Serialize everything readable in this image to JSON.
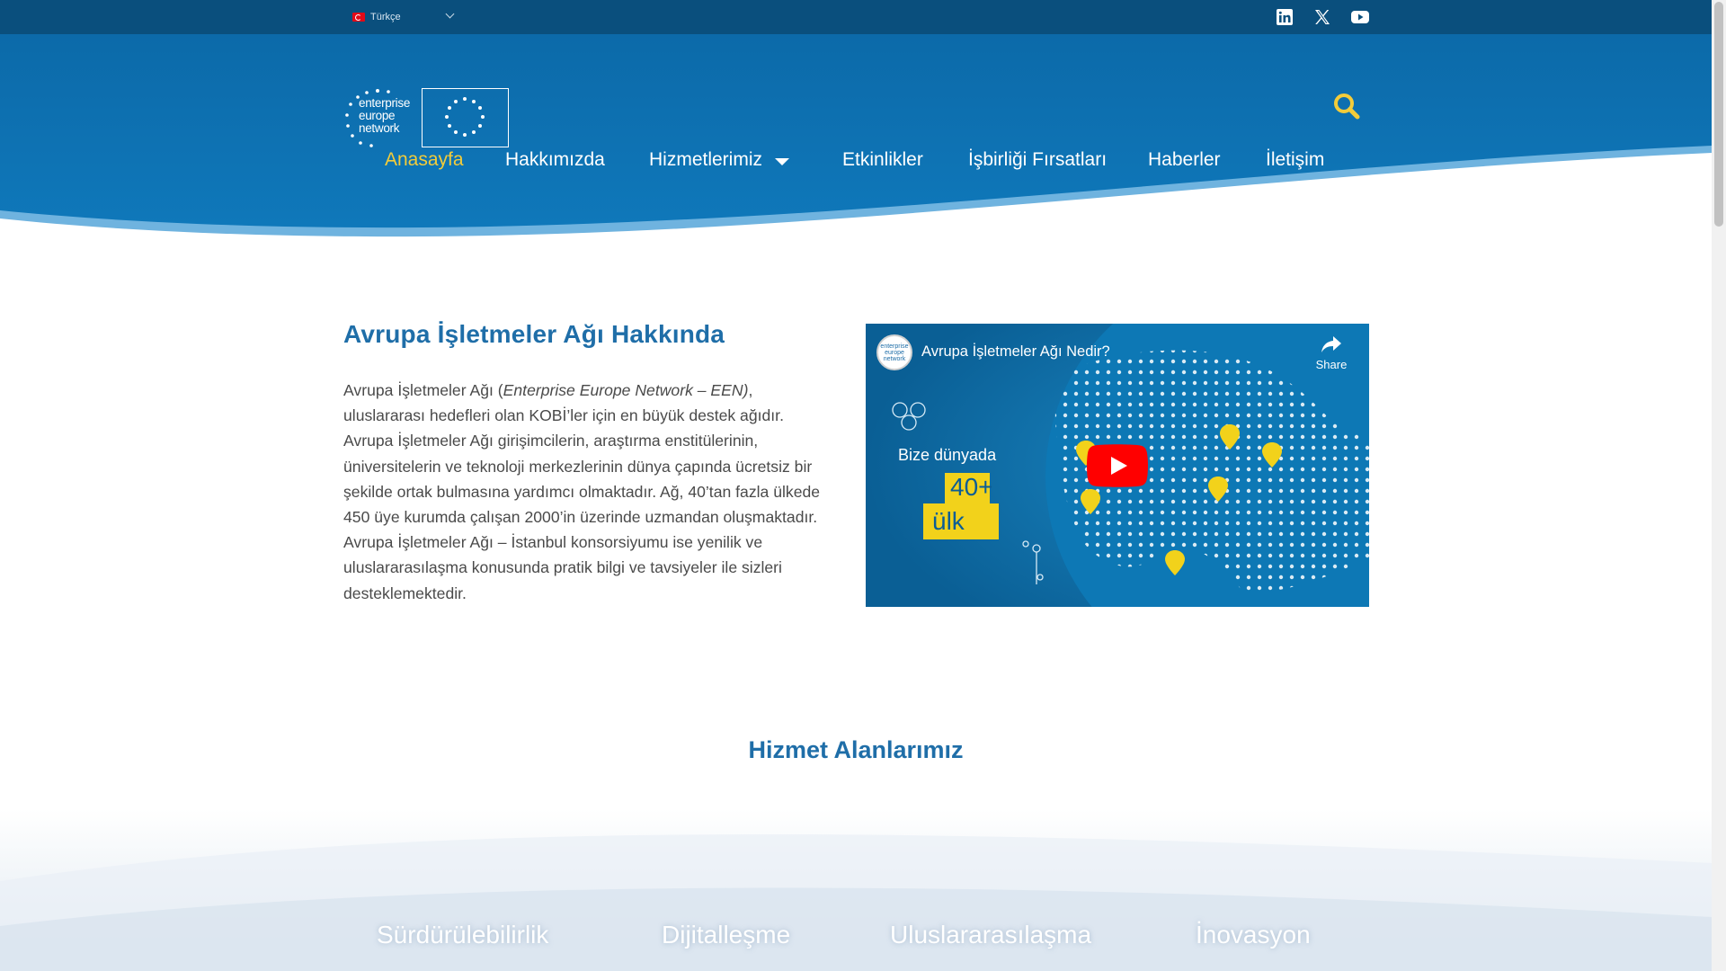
{
  "topbar": {
    "language": "Türkçe",
    "social": [
      "linkedin-icon",
      "x-icon",
      "youtube-icon"
    ]
  },
  "header": {
    "logo_text": [
      "enterprise",
      "europe",
      "network"
    ],
    "nav": [
      {
        "label": "Anasayfa",
        "active": true
      },
      {
        "label": "Hakkımızda"
      },
      {
        "label": "Hizmetlerimiz",
        "has_dropdown": true
      },
      {
        "label": "Etkinlikler"
      },
      {
        "label": "İşbirliği Fırsatları"
      },
      {
        "label": "Haberler"
      },
      {
        "label": "İletişim"
      }
    ]
  },
  "about": {
    "title": "Avrupa İşletmeler Ağı Hakkında",
    "text_pre": "Avrupa İşletmeler Ağı (",
    "text_italic": "Enterprise Europe Network – EEN)",
    "text_post": ", uluslararası hedefleri olan KOBİ’ler için en büyük destek ağıdır. Avrupa İşletmeler Ağı girişimcilerin, araştırma enstitülerinin, üniversitelerin ve teknoloji merkezlerinin dünya çapında ücretsiz bir şekilde ortak bulmasına yardımcı olmaktadır. Ağ, 40’tan fazla ülkede 450 üye kurumda çalışan 2000’in üzerinde uzmandan oluşmaktadır. Avrupa İşletmeler Ağı – İstanbul konsorsiyumu ise yenilik ve uluslararasılaşma konusunda pratik bilgi ve tavsiyeler ile sizleri desteklemektedir."
  },
  "video": {
    "channel_avatar_text": "enterprise europe network",
    "title": "Avrupa İşletmeler Ağı Nedir?",
    "share_label": "Share",
    "overlay_line1": "Bize dünyada",
    "overlay_big1": "40+",
    "overlay_big2": "ülk"
  },
  "services": {
    "title": "Hizmet Alanlarımız",
    "items": [
      "Sürdürülebilirlik",
      "Dijitalleşme",
      "Uluslararasılaşma",
      "İnovasyon"
    ]
  },
  "colors": {
    "topbar": "#0a4f7d",
    "header_blue": "#0a6aa8",
    "accent_yellow": "#f3cc3a",
    "title_blue": "#1f6ea8"
  }
}
